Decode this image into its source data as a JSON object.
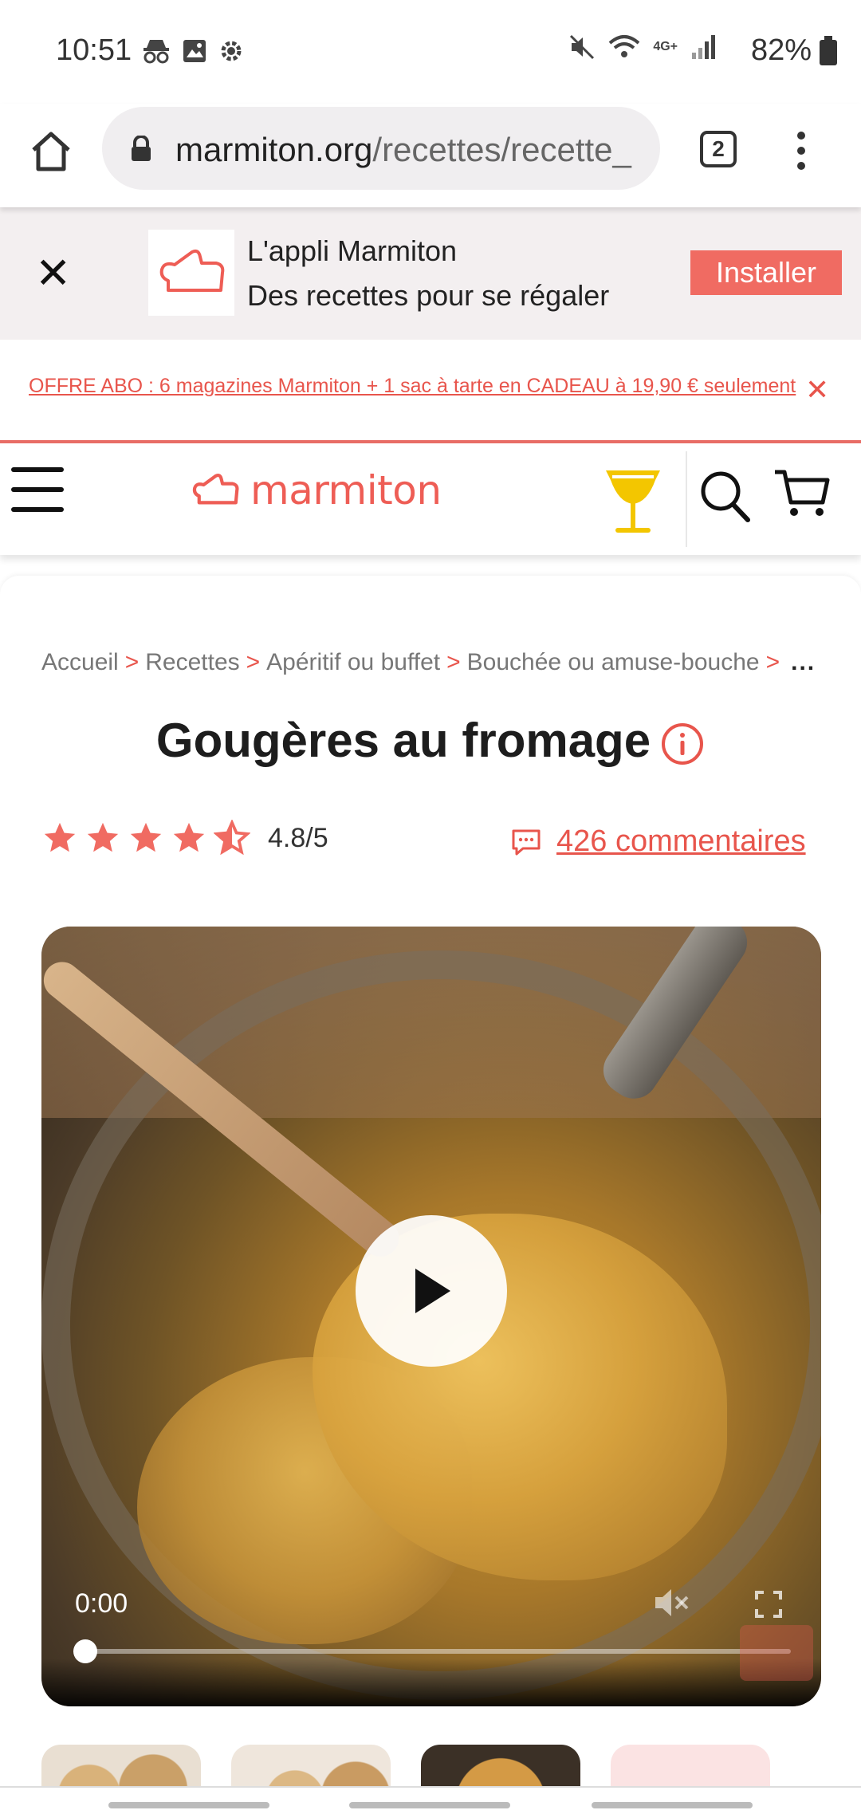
{
  "status": {
    "time": "10:51",
    "battery": "82%",
    "network": "4G+"
  },
  "browser": {
    "url_domain": "marmiton.org",
    "url_path": "/recettes/recette_",
    "tab_count": "2"
  },
  "app_banner": {
    "title": "L'appli Marmiton",
    "subtitle": "Des recettes pour se régaler",
    "install_label": "Installer"
  },
  "offer": {
    "text": "OFFRE ABO : 6 magazines Marmiton + 1 sac à tarte en CADEAU à 19,90 € seulement",
    "close_glyph": "✕"
  },
  "header": {
    "logo_text": "marmiton"
  },
  "breadcrumb": {
    "items": [
      "Accueil",
      "Recettes",
      "Apéritif ou buffet",
      "Bouchée ou amuse-bouche"
    ],
    "separator": ">",
    "more": "..."
  },
  "recipe": {
    "title": "Gougères au fromage",
    "rating": "4.8/5",
    "rating_value": 4.8,
    "comments": "426 commentaires"
  },
  "video": {
    "time": "0:00",
    "progress": 0
  },
  "colors": {
    "brand": "#e8554c",
    "install_bg": "#f06b62",
    "cocktail": "#f3c600"
  }
}
